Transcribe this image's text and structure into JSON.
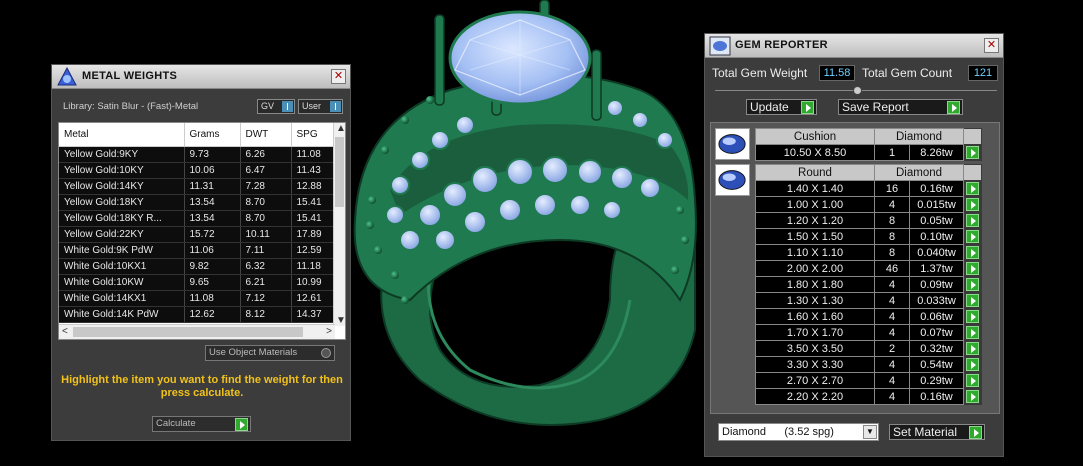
{
  "metal_weights": {
    "title": "METAL WEIGHTS",
    "library": "Library: Satin Blur - (Fast)-Metal",
    "toggle_gv": "GV",
    "toggle_user": "User",
    "columns": [
      "Metal",
      "Grams",
      "DWT",
      "SPG"
    ],
    "rows": [
      [
        "Yellow Gold:9KY",
        "9.73",
        "6.26",
        "11.08"
      ],
      [
        "Yellow Gold:10KY",
        "10.06",
        "6.47",
        "11.43"
      ],
      [
        "Yellow Gold:14KY",
        "11.31",
        "7.28",
        "12.88"
      ],
      [
        "Yellow Gold:18KY",
        "13.54",
        "8.70",
        "15.41"
      ],
      [
        "Yellow Gold:18KY R...",
        "13.54",
        "8.70",
        "15.41"
      ],
      [
        "Yellow Gold:22KY",
        "15.72",
        "10.11",
        "17.89"
      ],
      [
        "White Gold:9K PdW",
        "11.06",
        "7.11",
        "12.59"
      ],
      [
        "White Gold:10KX1",
        "9.82",
        "6.32",
        "11.18"
      ],
      [
        "White Gold:10KW",
        "9.65",
        "6.21",
        "10.99"
      ],
      [
        "White Gold:14KX1",
        "11.08",
        "7.12",
        "12.61"
      ],
      [
        "White Gold:14K PdW",
        "12.62",
        "8.12",
        "14.37"
      ]
    ],
    "use_object_materials": "Use Object Materials",
    "hint": "Highlight the item you want to find the weight for then press calculate.",
    "calculate_label": "Calculate"
  },
  "gem_reporter": {
    "title": "GEM REPORTER",
    "total_weight_label": "Total Gem Weight",
    "total_weight": "11.58",
    "total_count_label": "Total Gem Count",
    "total_count": "121",
    "update_label": "Update",
    "save_report_label": "Save Report",
    "cushion": {
      "shape": "Cushion",
      "material": "Diamond",
      "rows": [
        [
          "10.50 X 8.50",
          "1",
          "8.26tw"
        ]
      ]
    },
    "round": {
      "shape": "Round",
      "material": "Diamond",
      "rows": [
        [
          "1.40 X 1.40",
          "16",
          "0.16tw"
        ],
        [
          "1.00 X 1.00",
          "4",
          "0.015tw"
        ],
        [
          "1.20 X 1.20",
          "8",
          "0.05tw"
        ],
        [
          "1.50 X 1.50",
          "8",
          "0.10tw"
        ],
        [
          "1.10 X 1.10",
          "8",
          "0.040tw"
        ],
        [
          "2.00 X 2.00",
          "46",
          "1.37tw"
        ],
        [
          "1.80 X 1.80",
          "4",
          "0.09tw"
        ],
        [
          "1.30 X 1.30",
          "4",
          "0.033tw"
        ],
        [
          "1.60 X 1.60",
          "4",
          "0.06tw"
        ],
        [
          "1.70 X 1.70",
          "4",
          "0.07tw"
        ],
        [
          "3.50 X 3.50",
          "2",
          "0.32tw"
        ],
        [
          "3.30 X 3.30",
          "4",
          "0.54tw"
        ],
        [
          "2.70 X 2.70",
          "4",
          "0.29tw"
        ],
        [
          "2.20 X 2.20",
          "4",
          "0.16tw"
        ]
      ]
    },
    "material_select": "Diamond      (3.52 spg)",
    "set_material_label": "Set Material"
  },
  "colors": {
    "ring": "#1f7a4f",
    "gem": "#a8c4f5",
    "accent_green": "#2faa2f",
    "hint_yellow": "#f2c21a"
  }
}
